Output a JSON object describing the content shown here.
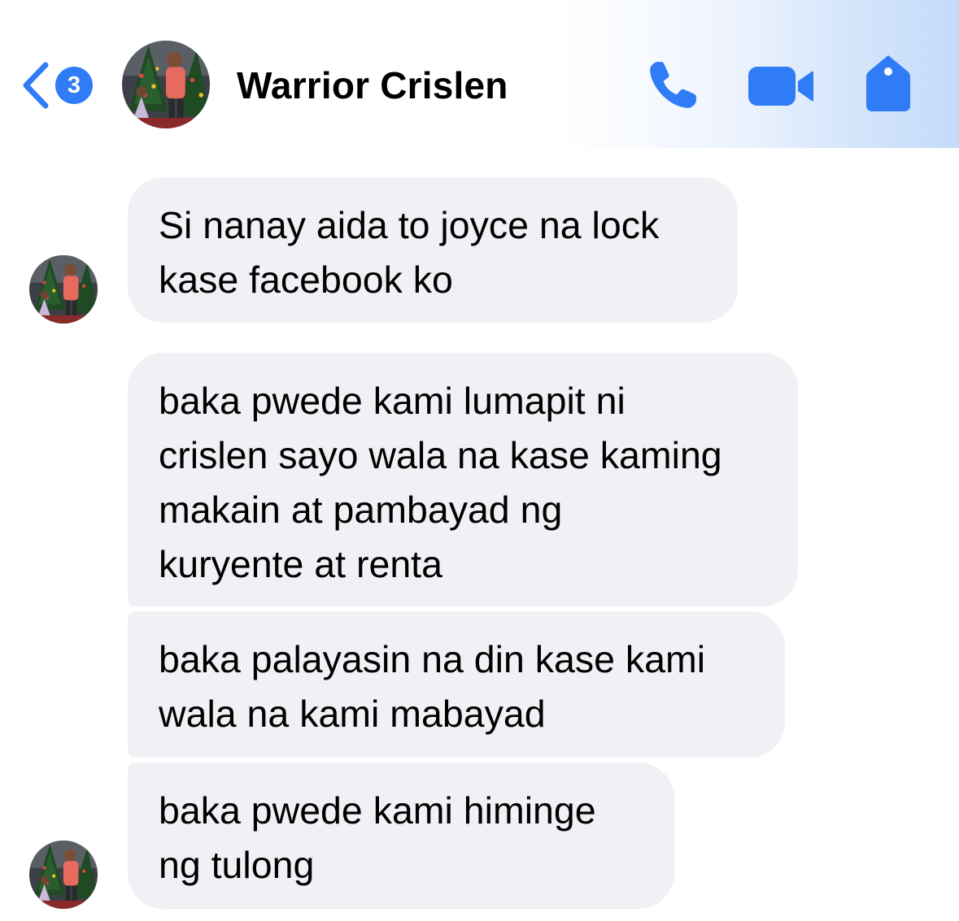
{
  "header": {
    "back_icon": "chevron-left-icon",
    "unread_count": "3",
    "contact_name": "Warrior Crislen",
    "actions": [
      {
        "name": "call-button",
        "icon": "phone-icon"
      },
      {
        "name": "video-call-button",
        "icon": "video-camera-icon"
      },
      {
        "name": "info-button",
        "icon": "tag-icon"
      }
    ],
    "accent_color": "#2f7cf6"
  },
  "messages": [
    {
      "text": "Si nanay aida to joyce na lock\nkase facebook ko"
    },
    {
      "text": "baka pwede kami lumapit ni\ncrislen sayo wala na kase kaming\nmakain at pambayad ng\nkuryente at renta"
    },
    {
      "text": "baka palayasin na din kase kami\nwala na kami mabayad"
    },
    {
      "text": "baka pwede kami himinge\nng tulong"
    }
  ],
  "colors": {
    "bubble_background": "#f0f0f5",
    "text": "#000000"
  }
}
